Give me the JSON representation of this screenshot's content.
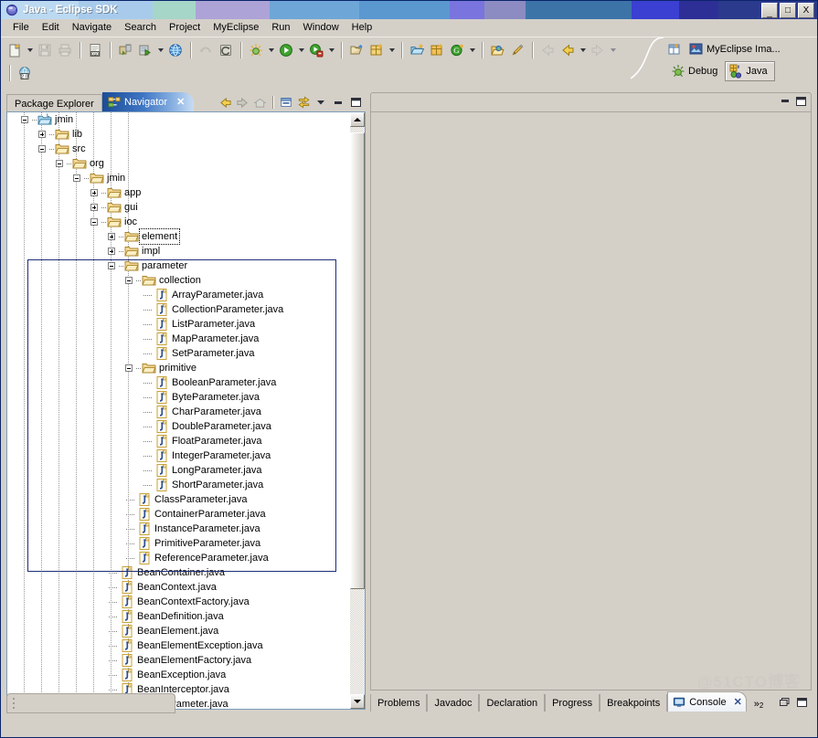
{
  "window": {
    "title": "Java - Eclipse SDK",
    "icon": "eclipse-icon",
    "minimize_label": "_",
    "maximize_label": "□",
    "close_label": "X",
    "titlebar_colors": [
      "#2b3a8c",
      "#2e2f96",
      "#3b3fd2",
      "#3d74a8",
      "#8d8cc2",
      "#7a74df",
      "#5b98d0",
      "#6fa6d8",
      "#ada3d6",
      "#a6d6c8",
      "#a8cbec",
      "#bcd9f2"
    ]
  },
  "menubar": {
    "items": [
      {
        "label": "File",
        "mnemonic": "F"
      },
      {
        "label": "Edit",
        "mnemonic": "E"
      },
      {
        "label": "Navigate",
        "mnemonic": "v"
      },
      {
        "label": "Search",
        "mnemonic": "a"
      },
      {
        "label": "Project",
        "mnemonic": "P"
      },
      {
        "label": "MyEclipse",
        "mnemonic": ""
      },
      {
        "label": "Run",
        "mnemonic": "R"
      },
      {
        "label": "Window",
        "mnemonic": "W"
      },
      {
        "label": "Help",
        "mnemonic": "H"
      }
    ]
  },
  "toolbar": {
    "row1": [
      {
        "name": "new-wizard-button",
        "icon": "new-file-icon",
        "dropdown": true
      },
      {
        "name": "save-button",
        "icon": "save-icon",
        "disabled": true
      },
      {
        "name": "print-button",
        "icon": "print-icon",
        "disabled": true
      },
      {
        "sep": true
      },
      {
        "name": "new-jsp-button",
        "icon": "document-010-icon"
      },
      {
        "sep": true
      },
      {
        "name": "deploy-button",
        "icon": "deploy-icon"
      },
      {
        "name": "run-server-button",
        "icon": "server-run-icon",
        "dropdown": true
      },
      {
        "name": "browser-button",
        "icon": "globe-icon"
      },
      {
        "sep": true
      },
      {
        "name": "previous-annotation-button",
        "icon": "prev-annotation-icon",
        "disabled": true
      },
      {
        "name": "last-edit-location-button",
        "icon": "last-edit-icon"
      },
      {
        "sep": true
      },
      {
        "name": "debug-button",
        "icon": "debug-bug-icon",
        "dropdown": true
      },
      {
        "name": "run-button",
        "icon": "run-green-icon",
        "dropdown": true
      },
      {
        "name": "external-tools-button",
        "icon": "external-tools-icon",
        "dropdown": true
      },
      {
        "sep": true
      },
      {
        "name": "open-type-button",
        "icon": "open-type-icon"
      },
      {
        "name": "new-package-button",
        "icon": "new-package-icon",
        "dropdown": true
      },
      {
        "sep": true
      },
      {
        "name": "new-java-project-button",
        "icon": "new-java-project-icon"
      },
      {
        "name": "new-class-button",
        "icon": "new-class-icon"
      },
      {
        "name": "new-annotation-button",
        "icon": "new-annotation-icon",
        "dropdown": true
      },
      {
        "sep": true
      },
      {
        "name": "open-resource-button",
        "icon": "open-folder-icon"
      },
      {
        "name": "search-button",
        "icon": "pencil-search-icon"
      },
      {
        "sep": true
      },
      {
        "name": "back-button",
        "icon": "back-arrow-icon",
        "disabled": true
      },
      {
        "name": "forward-button",
        "icon": "yellow-left-arrow-icon",
        "dropdown": true
      },
      {
        "name": "next-button",
        "icon": "gray-right-arrow-icon",
        "dropdown": true,
        "disabled": true
      }
    ],
    "row2": [
      {
        "name": "jdk-version-button",
        "icon": "jdk-20-icon"
      }
    ]
  },
  "perspective": {
    "open_perspective_name": "open-perspective-icon",
    "current": "MyEclipse Ima...",
    "current_icon": "myeclipse-image-icon",
    "buttons": [
      {
        "label": "Debug",
        "icon": "debug-perspective-icon",
        "active": false
      },
      {
        "label": "Java",
        "icon": "java-perspective-icon",
        "active": true
      }
    ]
  },
  "left_view": {
    "tabs": [
      {
        "label": "Package Explorer",
        "active": false,
        "icon": null
      },
      {
        "label": "Navigator",
        "active": true,
        "icon": "navigator-icon",
        "closable": true,
        "close_label": "✕"
      }
    ],
    "toolbar": [
      {
        "name": "back-icon",
        "label": "back"
      },
      {
        "name": "forward-icon",
        "label": "forward"
      },
      {
        "name": "home-icon",
        "label": "home"
      },
      {
        "name": "collapse-all-icon",
        "label": "collapse-all"
      },
      {
        "name": "link-with-editor-icon",
        "label": "link-with-editor"
      },
      {
        "name": "view-menu-icon",
        "label": "view-menu"
      },
      {
        "name": "minimize-icon",
        "label": "minimize"
      },
      {
        "name": "maximize-icon",
        "label": "maximize"
      }
    ],
    "tree": [
      {
        "label": "jmin",
        "depth": 0,
        "expander": "minus",
        "icon": "project-icon"
      },
      {
        "label": "lib",
        "depth": 1,
        "expander": "plus",
        "icon": "folder-icon"
      },
      {
        "label": "src",
        "depth": 1,
        "expander": "minus",
        "icon": "folder-icon"
      },
      {
        "label": "org",
        "depth": 2,
        "expander": "minus",
        "icon": "folder-icon"
      },
      {
        "label": "jmin",
        "depth": 3,
        "expander": "minus",
        "icon": "folder-icon"
      },
      {
        "label": "app",
        "depth": 4,
        "expander": "plus",
        "icon": "folder-icon"
      },
      {
        "label": "gui",
        "depth": 4,
        "expander": "plus",
        "icon": "folder-icon"
      },
      {
        "label": "ioc",
        "depth": 4,
        "expander": "minus",
        "icon": "folder-icon"
      },
      {
        "label": "element",
        "depth": 5,
        "expander": "plus",
        "icon": "folder-icon",
        "focus": true
      },
      {
        "label": "impl",
        "depth": 5,
        "expander": "plus",
        "icon": "folder-icon"
      },
      {
        "label": "parameter",
        "depth": 5,
        "expander": "minus",
        "icon": "folder-icon"
      },
      {
        "label": "collection",
        "depth": 6,
        "expander": "minus",
        "icon": "folder-icon"
      },
      {
        "label": "ArrayParameter.java",
        "depth": 7,
        "expander": "none",
        "icon": "java-file-icon"
      },
      {
        "label": "CollectionParameter.java",
        "depth": 7,
        "expander": "none",
        "icon": "java-file-icon"
      },
      {
        "label": "ListParameter.java",
        "depth": 7,
        "expander": "none",
        "icon": "java-file-icon"
      },
      {
        "label": "MapParameter.java",
        "depth": 7,
        "expander": "none",
        "icon": "java-file-icon"
      },
      {
        "label": "SetParameter.java",
        "depth": 7,
        "expander": "none",
        "icon": "java-file-icon"
      },
      {
        "label": "primitive",
        "depth": 6,
        "expander": "minus",
        "icon": "folder-icon"
      },
      {
        "label": "BooleanParameter.java",
        "depth": 7,
        "expander": "none",
        "icon": "java-file-icon"
      },
      {
        "label": "ByteParameter.java",
        "depth": 7,
        "expander": "none",
        "icon": "java-file-icon"
      },
      {
        "label": "CharParameter.java",
        "depth": 7,
        "expander": "none",
        "icon": "java-file-icon"
      },
      {
        "label": "DoubleParameter.java",
        "depth": 7,
        "expander": "none",
        "icon": "java-file-icon"
      },
      {
        "label": "FloatParameter.java",
        "depth": 7,
        "expander": "none",
        "icon": "java-file-icon"
      },
      {
        "label": "IntegerParameter.java",
        "depth": 7,
        "expander": "none",
        "icon": "java-file-icon"
      },
      {
        "label": "LongParameter.java",
        "depth": 7,
        "expander": "none",
        "icon": "java-file-icon"
      },
      {
        "label": "ShortParameter.java",
        "depth": 7,
        "expander": "none",
        "icon": "java-file-icon"
      },
      {
        "label": "ClassParameter.java",
        "depth": 6,
        "expander": "none",
        "icon": "java-file-icon"
      },
      {
        "label": "ContainerParameter.java",
        "depth": 6,
        "expander": "none",
        "icon": "java-file-icon"
      },
      {
        "label": "InstanceParameter.java",
        "depth": 6,
        "expander": "none",
        "icon": "java-file-icon"
      },
      {
        "label": "PrimitiveParameter.java",
        "depth": 6,
        "expander": "none",
        "icon": "java-file-icon"
      },
      {
        "label": "ReferenceParameter.java",
        "depth": 6,
        "expander": "none",
        "icon": "java-file-icon"
      },
      {
        "label": "BeanContainer.java",
        "depth": 5,
        "expander": "none",
        "icon": "java-file-icon"
      },
      {
        "label": "BeanContext.java",
        "depth": 5,
        "expander": "none",
        "icon": "java-file-icon"
      },
      {
        "label": "BeanContextFactory.java",
        "depth": 5,
        "expander": "none",
        "icon": "java-file-icon"
      },
      {
        "label": "BeanDefinition.java",
        "depth": 5,
        "expander": "none",
        "icon": "java-file-icon"
      },
      {
        "label": "BeanElement.java",
        "depth": 5,
        "expander": "none",
        "icon": "java-file-icon"
      },
      {
        "label": "BeanElementException.java",
        "depth": 5,
        "expander": "none",
        "icon": "java-file-icon"
      },
      {
        "label": "BeanElementFactory.java",
        "depth": 5,
        "expander": "none",
        "icon": "java-file-icon"
      },
      {
        "label": "BeanException.java",
        "depth": 5,
        "expander": "none",
        "icon": "java-file-icon"
      },
      {
        "label": "BeanInterceptor.java",
        "depth": 5,
        "expander": "none",
        "icon": "java-file-icon"
      },
      {
        "label": "BeanParameter.java",
        "depth": 5,
        "expander": "none",
        "icon": "java-file-icon"
      }
    ],
    "selection_marquee": {
      "from_row": 10,
      "to_row": 30
    }
  },
  "editor_area": {
    "tabs": [],
    "controls": [
      {
        "name": "minimize-icon"
      },
      {
        "name": "maximize-icon"
      }
    ]
  },
  "bottom_view": {
    "tabs": [
      {
        "label": "Problems",
        "active": false
      },
      {
        "label": "Javadoc",
        "active": false
      },
      {
        "label": "Declaration",
        "active": false
      },
      {
        "label": "Progress",
        "active": false
      },
      {
        "label": "Breakpoints",
        "active": false
      },
      {
        "label": "Console",
        "active": true,
        "icon": "console-icon",
        "closable": true,
        "close_label": "✕"
      }
    ],
    "overflow_label": "»",
    "overflow_count": "2",
    "controls": [
      {
        "name": "restore-icon"
      },
      {
        "name": "maximize-icon"
      }
    ]
  },
  "watermark": {
    "text": "@51CTO博客"
  }
}
